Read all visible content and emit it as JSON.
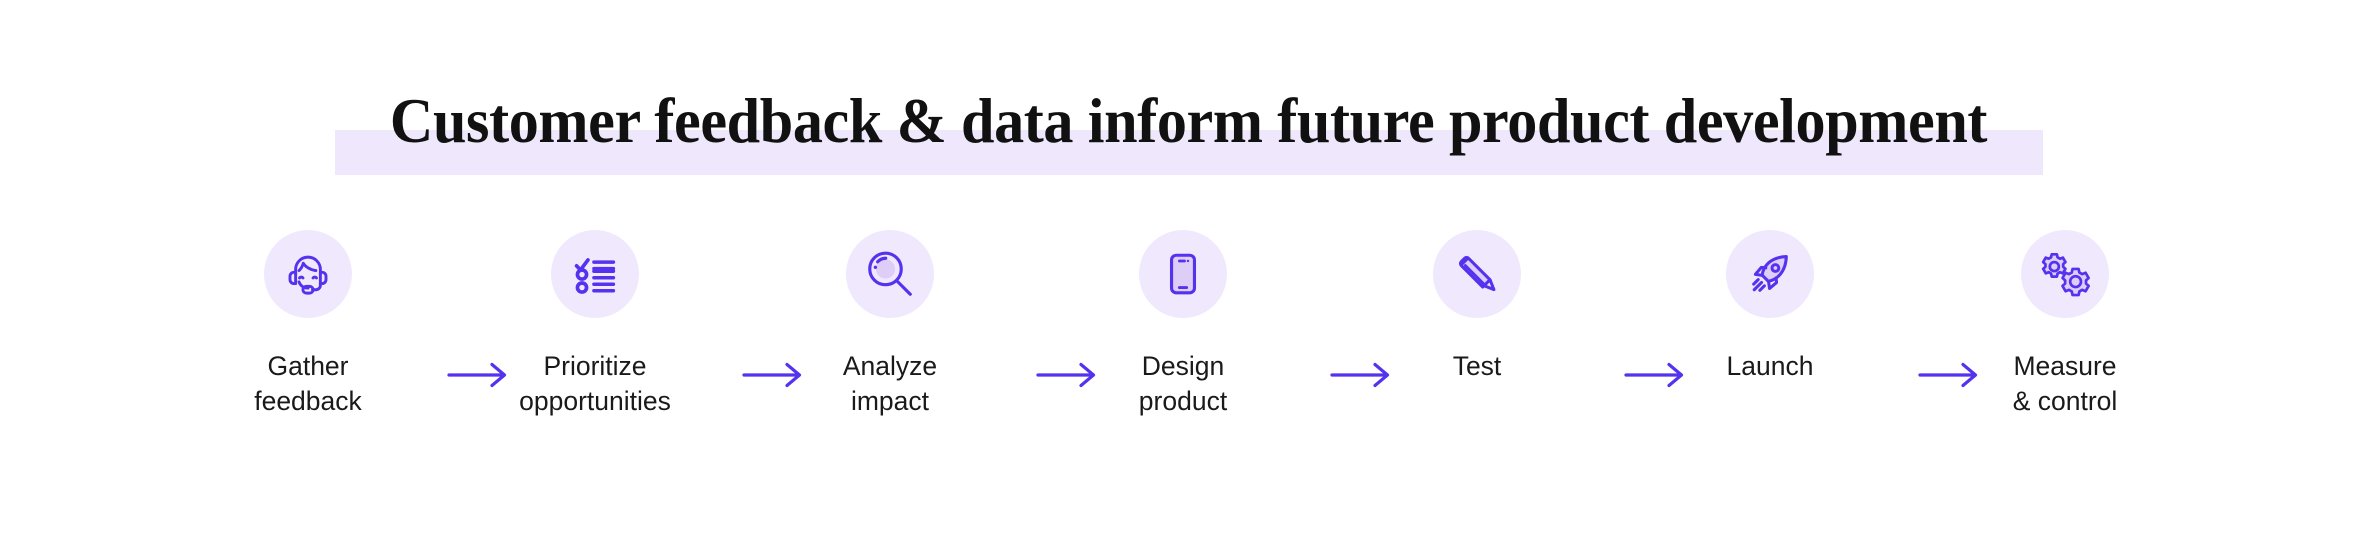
{
  "slide": {
    "background_color": "#FFFFFF",
    "title": "Customer feedback & data inform future product development",
    "title_highlight_color": "#EFE7FB",
    "title_text_color": "#111111"
  },
  "theme": {
    "accent_color": "#5532EE",
    "icon_circle_color": "#F0E8FC",
    "icon_fill_color": "#DDCDF7",
    "label_color": "#1A1A1A"
  },
  "flow": {
    "steps": [
      {
        "label": "Gather\nfeedback",
        "icon": "headset-support-agent-icon"
      },
      {
        "label": "Prioritize\nopportunities",
        "icon": "checklist-icon"
      },
      {
        "label": "Analyze\nimpact",
        "icon": "magnifying-glass-icon"
      },
      {
        "label": "Design\nproduct",
        "icon": "smartphone-icon"
      },
      {
        "label": "Test",
        "icon": "pencil-icon"
      },
      {
        "label": "Launch",
        "icon": "rocket-icon"
      },
      {
        "label": "Measure\n& control",
        "icon": "gears-icon"
      }
    ],
    "connectors": [
      {
        "icon": "arrow-right-icon"
      },
      {
        "icon": "arrow-right-icon"
      },
      {
        "icon": "arrow-right-icon"
      },
      {
        "icon": "arrow-right-icon"
      },
      {
        "icon": "arrow-right-icon"
      },
      {
        "icon": "arrow-right-icon"
      }
    ]
  }
}
